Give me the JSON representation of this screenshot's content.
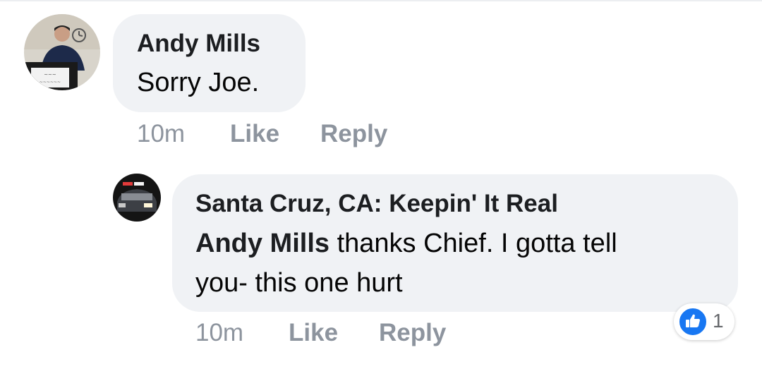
{
  "comments": [
    {
      "author": "Andy Mills",
      "text": "Sorry Joe.",
      "time": "10m",
      "like_label": "Like",
      "reply_label": "Reply",
      "avatar_icon": "person-podium-avatar"
    }
  ],
  "replies": [
    {
      "author": "Santa Cruz, CA: Keepin' It Real",
      "mention": "Andy Mills",
      "text_line1": "thanks Chief. I gotta tell",
      "text_line2": "you- this one hurt",
      "time": "10m",
      "like_label": "Like",
      "reply_label": "Reply",
      "avatar_icon": "police-car-avatar",
      "reactions": {
        "icon": "thumbs-up-icon",
        "count": "1"
      }
    }
  ],
  "colors": {
    "bubble": "#f0f2f5",
    "meta_text": "#8d949e",
    "like_blue": "#1877f2"
  }
}
